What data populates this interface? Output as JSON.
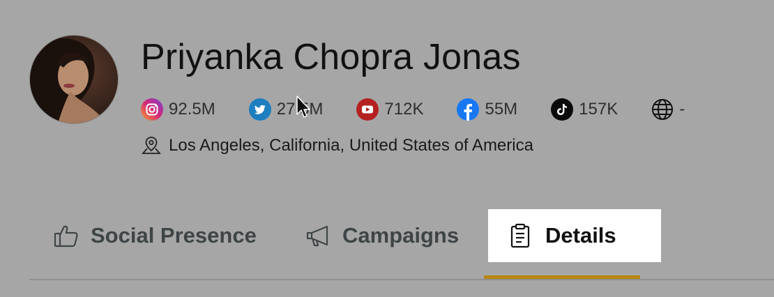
{
  "profile": {
    "name": "Priyanka Chopra Jonas",
    "location": "Los Angeles, California, United States of America"
  },
  "stats": [
    {
      "platform": "instagram",
      "icon": "instagram-icon",
      "value": "92.5M",
      "color": "#d62976"
    },
    {
      "platform": "twitter",
      "icon": "twitter-icon",
      "value": "27.5M",
      "color": "#1d9bf0"
    },
    {
      "platform": "youtube",
      "icon": "youtube-icon",
      "value": "712K",
      "color": "#b52121"
    },
    {
      "platform": "facebook",
      "icon": "facebook-icon",
      "value": "55M",
      "color": "#1877f2"
    },
    {
      "platform": "tiktok",
      "icon": "tiktok-icon",
      "value": "157K",
      "color": "#000000"
    },
    {
      "platform": "website",
      "icon": "globe-icon",
      "value": "-",
      "color": "#111111"
    }
  ],
  "tabs": {
    "social": "Social Presence",
    "campaigns": "Campaigns",
    "details": "Details",
    "active": "details",
    "accent": "#b8860b"
  }
}
